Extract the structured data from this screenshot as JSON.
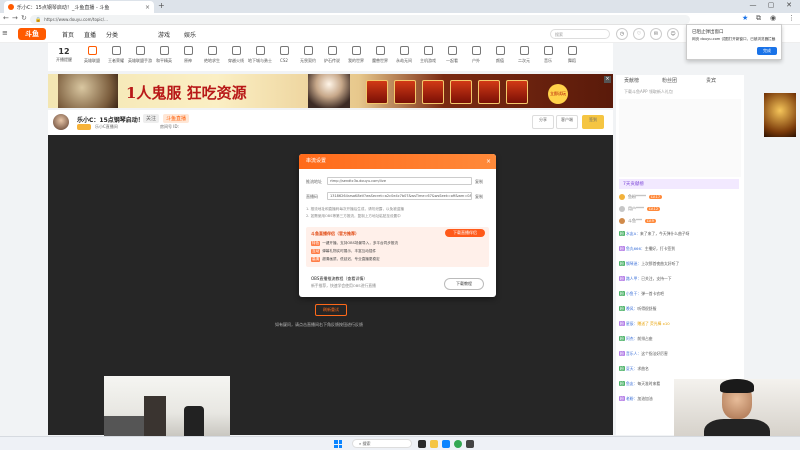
{
  "browser": {
    "tab_title": "乐小C：15点钢琴启动！_斗鱼直播 - 斗鱼",
    "url": "https://www.douyu.com/topic/...",
    "new_tab": "+",
    "win_min": "—",
    "win_max": "▢",
    "win_close": "✕",
    "back": "←",
    "forward": "→",
    "reload": "↻",
    "star": "★",
    "menu": "⋮"
  },
  "site": {
    "logo": "斗鱼",
    "nav": [
      "首页",
      "直播",
      "分类",
      "游戏",
      "娱乐"
    ],
    "search_placeholder": "搜索"
  },
  "categories": [
    "12",
    "开播提醒",
    "英雄联盟",
    "王者荣耀",
    "英雄联盟手游",
    "和平精英",
    "原神",
    "绝地求生",
    "穿越火线",
    "地下城与勇士",
    "CS2",
    "无畏契约",
    "炉石传说",
    "我的世界",
    "魔兽世界",
    "永劫无间",
    "主机游戏",
    "一起看",
    "户外",
    "颜值",
    "二次元",
    "音乐",
    "舞蹈"
  ],
  "banner": {
    "slogan": "1人鬼服 狂吃资源",
    "cta": "立即试玩",
    "close": "×"
  },
  "room": {
    "title": "乐小C：15点钢琴启动！",
    "badge1": "关注",
    "badge2": "斗鱼直播",
    "sub1": "乐小C直播间",
    "sub2": "房间号 ID:",
    "btn1": "分享",
    "btn2": "客户端",
    "btn3": "签到"
  },
  "dialog": {
    "title": "串流设置",
    "close": "×",
    "row1_label": "推流地址",
    "row1_value": "rtmp://sendtc3a.douyu.com/live",
    "row1_link": "复制",
    "row2_label": "直播码",
    "row2_value": "13186264rzsaK8eV?wsSecret=a2c0e4c7b07&wsTime=67&wsSeek=off&wm=0&tw=0",
    "row2_link": "复制",
    "note1": "1. 推流地址和直播码每次开播后生成，请勿泄露，以免被盗播",
    "note2": "2. 如需使用OBS等第三方推流，复制上方地址粘贴至设置中",
    "panel_title": "斗鱼直播伴侣（官方推荐）",
    "panel_btn": "下载直播伴侣",
    "panel_lines": [
      {
        "tag": "特色",
        "text": "一键开播，支持OBS场景导入，多平台同步推流"
      },
      {
        "tag": "互动",
        "text": "弹幕礼物实时展示，丰富互动插件"
      },
      {
        "tag": "高清",
        "text": "超清画质，低延迟，专业直播更稳定"
      }
    ],
    "foot_title": "OBS直播推流教程（查看详情）",
    "foot_sub": "新手推荐，快速学会使用OBS进行直播",
    "foot_btn": "下载教程"
  },
  "player": {
    "err_btn": "刷新重试",
    "err_text": "如有疑问，请点击直播间右下角反馈按钮进行反馈"
  },
  "sidebar": {
    "tabs": [
      "贡献榜",
      "粉丝团",
      "贵宾"
    ],
    "promo": "下载斗鱼APP 领取新人礼包",
    "rank_header": "7天贡献榜",
    "ranks": [
      {
        "name": "鱼粉*****",
        "pill": "LV.17"
      },
      {
        "name": "用户****",
        "pill": "LV.12"
      },
      {
        "name": "斗鱼***",
        "pill": "LV.9"
      }
    ],
    "chats": [
      {
        "user": "水友A：",
        "msg": "来了来了，今天弹什么曲子呀"
      },
      {
        "user": "鱼丸666：",
        "msg": "主播好，打卡签到"
      },
      {
        "user": "钢琴迷：",
        "msg": "上次那首夜曲太好听了"
      },
      {
        "user": "路人甲：",
        "msg": "已关注，支持一下"
      },
      {
        "user": "小鱼干：",
        "msg": "弹一首卡农吧"
      },
      {
        "user": "晚风：",
        "msg": "听得很舒服"
      },
      {
        "user": "星辰：",
        "msg": "赠送了 荧光棒 x10"
      },
      {
        "user": "阿杰：",
        "msg": "前排占座"
      },
      {
        "user": "音乐人：",
        "msg": "这个指法好厉害"
      },
      {
        "user": "夏天：",
        "msg": "求曲名"
      },
      {
        "user": "鱼友：",
        "msg": "每天准时来看"
      },
      {
        "user": "老粉：",
        "msg": "加油加油"
      }
    ]
  },
  "popup": {
    "title": "已阻止弹出窗口",
    "body": "网页 douyu.com 试图打开新窗口，已被浏览器拦截",
    "btn": "完成"
  },
  "taskbar": {
    "search": "搜索"
  },
  "colors": {
    "brand": "#ff5a00",
    "dialog_header": "#ff6a1a",
    "player_bg": "#262626",
    "popup_button": "#1a73e8"
  }
}
